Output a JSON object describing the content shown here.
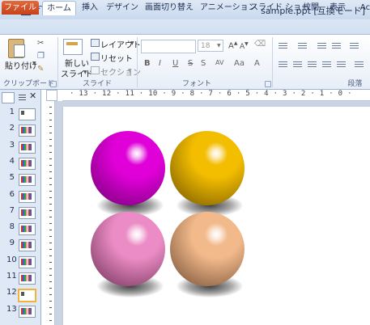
{
  "window": {
    "app_logo_letter": "P",
    "title": "sample.ppt [互換モード]"
  },
  "tabs": {
    "file": "ファイル",
    "home": "ホーム",
    "insert": "挿入",
    "design": "デザイン",
    "transitions": "画面切り替え",
    "animations": "アニメーション",
    "slideshow": "スライド ショー",
    "review": "校閲",
    "view": "表示",
    "acrobat": "Ac"
  },
  "ribbon": {
    "clipboard": {
      "paste_label": "貼り付け",
      "group_label": "クリップボード"
    },
    "slides": {
      "new_slide_line1": "新しい",
      "new_slide_line2": "スライド",
      "layout_label": "レイアウト",
      "reset_label": "リセット",
      "section_label": "セクション",
      "group_label": "スライド"
    },
    "font": {
      "font_size": "18",
      "grow_glyph": "A",
      "shrink_glyph": "A",
      "bold": "B",
      "italic": "I",
      "underline": "U",
      "strike": "S",
      "shadow": "S",
      "spacing": "AV",
      "case": "Aa",
      "font_color": "A",
      "group_label": "フォント"
    },
    "paragraph": {
      "group_label": "段落"
    }
  },
  "thumbnails": {
    "numbers": [
      "1",
      "2",
      "3",
      "4",
      "5",
      "6",
      "7",
      "8",
      "9",
      "10",
      "11",
      "12",
      "13"
    ],
    "selected_index": 12
  },
  "ruler": {
    "horizontal_text": "· 13 · 12 · 11 · 10 · 9 · 8 · 7 · 6 · 5 · 4 · 3 · 2 · 1 · 0 ·"
  },
  "slide": {
    "balls": [
      {
        "name": "magenta-sphere",
        "color": "#e000d8",
        "dark": "#6e0070"
      },
      {
        "name": "gold-sphere",
        "color": "#f3bd00",
        "dark": "#6f5200"
      },
      {
        "name": "pink-sphere",
        "color": "#ec8cc6",
        "dark": "#6a2e52"
      },
      {
        "name": "peach-sphere",
        "color": "#f2b98b",
        "dark": "#6e4a30"
      }
    ]
  },
  "colors": {
    "file_tab": "#d24726",
    "selected_thumb_border": "#f0b43c",
    "ribbon_bg": "#e7eef8"
  }
}
